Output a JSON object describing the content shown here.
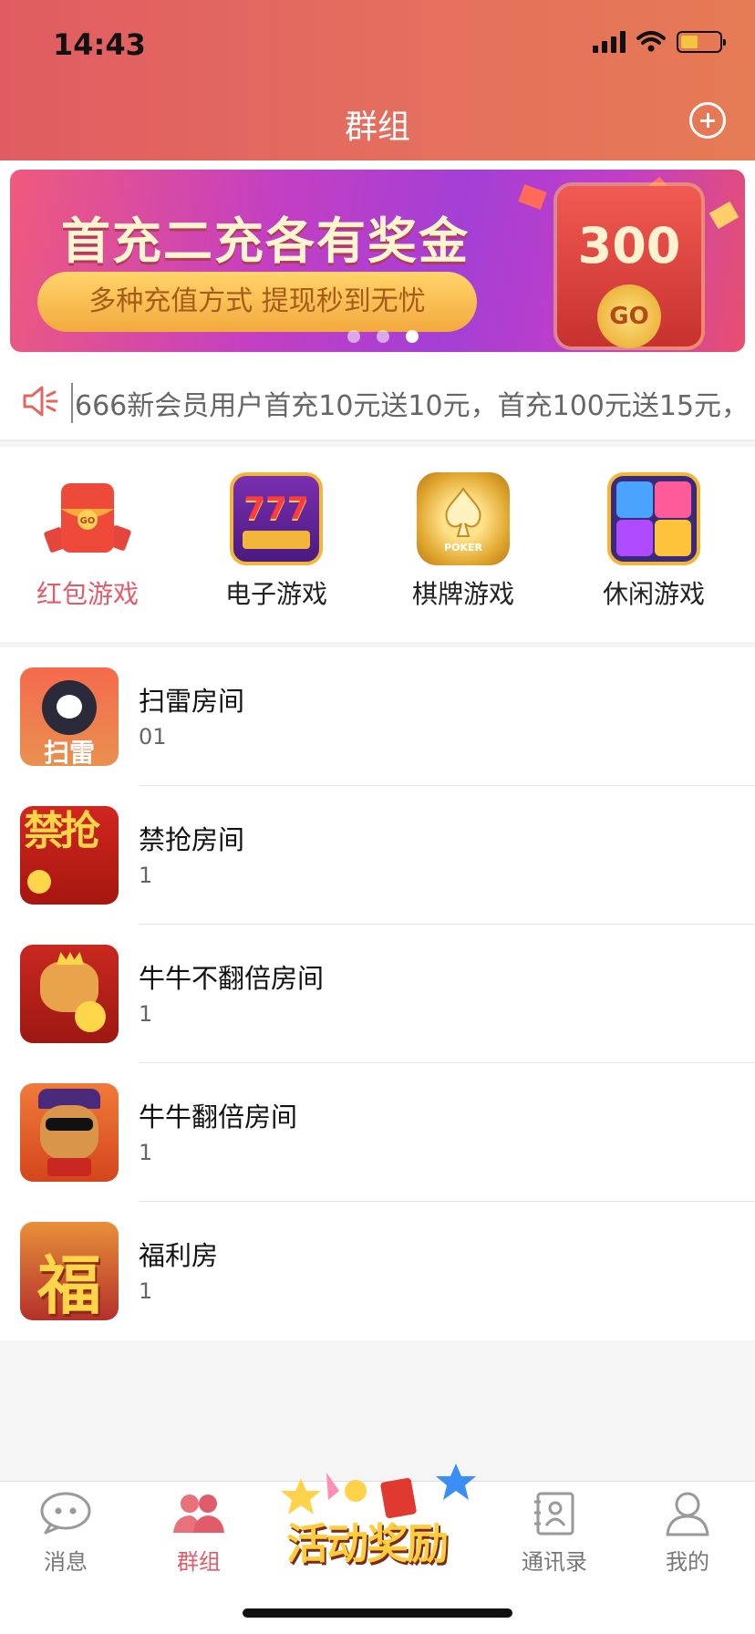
{
  "status": {
    "time": "14:43"
  },
  "header": {
    "title": "群组"
  },
  "banner": {
    "title": "首充二充各有奖金",
    "subtitle": "多种充值方式  提现秒到无忧",
    "amount": "300",
    "go_label": "GO",
    "page_count": 3,
    "active_page": 2
  },
  "notice": {
    "text": "666新会员用户首充10元送10元，首充100元送15元，"
  },
  "categories": [
    {
      "label": "红包游戏",
      "icon": "red-envelope-icon",
      "active": true
    },
    {
      "label": "电子游戏",
      "icon": "slot-777-icon",
      "icon_text": "777",
      "active": false
    },
    {
      "label": "棋牌游戏",
      "icon": "poker-chip-icon",
      "icon_text": "POKER",
      "active": false
    },
    {
      "label": "休闲游戏",
      "icon": "gem-blocks-icon",
      "active": false
    }
  ],
  "rooms": [
    {
      "name": "扫雷房间",
      "sub": "01",
      "icon": "minesweeper-bomb-icon",
      "icon_text": "扫雷"
    },
    {
      "name": "禁抢房间",
      "sub": "1",
      "icon": "no-grab-icon",
      "icon_text": "禁抢"
    },
    {
      "name": "牛牛不翻倍房间",
      "sub": "1",
      "icon": "bull-cartoon-icon"
    },
    {
      "name": "牛牛翻倍房间",
      "sub": "1",
      "icon": "bull-sunglasses-icon"
    },
    {
      "name": "福利房",
      "sub": "1",
      "icon": "fortune-character-icon",
      "icon_text": "福"
    }
  ],
  "tabbar": {
    "items": [
      {
        "label": "消息",
        "icon": "chat-bubble-icon",
        "active": false
      },
      {
        "label": "群组",
        "icon": "group-people-icon",
        "active": true
      },
      {
        "label": "通讯录",
        "icon": "contacts-book-icon",
        "active": false
      },
      {
        "label": "我的",
        "icon": "person-icon",
        "active": false
      }
    ],
    "promo_label": "活动奖励"
  },
  "colors": {
    "accent": "#e05c6a",
    "header_start": "#e05c62",
    "header_end": "#e67a55"
  }
}
